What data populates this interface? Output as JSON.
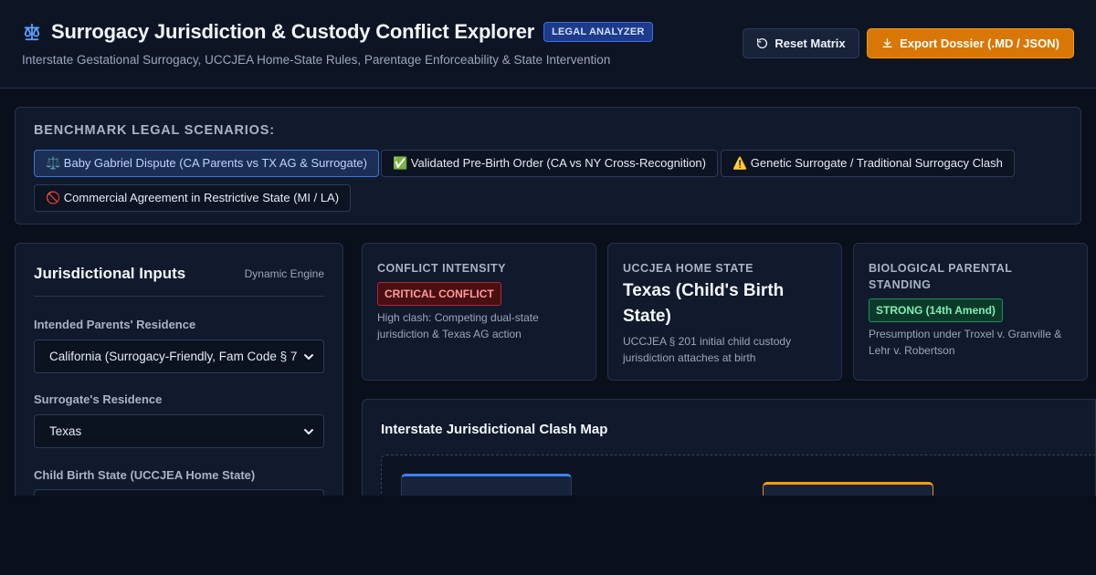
{
  "header": {
    "title": "Surrogacy Jurisdiction & Custody Conflict Explorer",
    "badge": "LEGAL ANALYZER",
    "subtitle": "Interstate Gestational Surrogacy, UCCJEA Home-State Rules, Parentage Enforceability & State Intervention",
    "icon": "scales-icon",
    "reset_label": "Reset Matrix",
    "export_label": "Export Dossier (.MD / JSON)"
  },
  "scenarios": {
    "title": "BENCHMARK LEGAL SCENARIOS:",
    "items": [
      {
        "label": "⚖️ Baby Gabriel Dispute (CA Parents vs TX AG & Surrogate)",
        "active": true
      },
      {
        "label": "✅ Validated Pre-Birth Order (CA vs NY Cross-Recognition)",
        "active": false
      },
      {
        "label": "⚠️ Genetic Surrogate / Traditional Surrogacy Clash",
        "active": false
      },
      {
        "label": "🚫 Commercial Agreement in Restrictive State (MI / LA)",
        "active": false
      }
    ]
  },
  "inputs": {
    "title": "Jurisdictional Inputs",
    "tag": "Dynamic Engine",
    "fields": [
      {
        "label": "Intended Parents' Residence",
        "value": "California (Surrogacy-Friendly, Fam Code § 7"
      },
      {
        "label": "Surrogate's Residence",
        "value": "Texas"
      },
      {
        "label": "Child Birth State (UCCJEA Home State)",
        "value": ""
      }
    ]
  },
  "cards": {
    "conflict": {
      "label": "CONFLICT INTENSITY",
      "pill": "CRITICAL CONFLICT",
      "desc": "High clash: Competing dual-state jurisdiction & Texas AG action"
    },
    "home_state": {
      "label": "UCCJEA HOME STATE",
      "value": "Texas (Child's Birth State)",
      "desc": "UCCJEA § 201 initial child custody jurisdiction attaches at birth"
    },
    "bio": {
      "label": "BIOLOGICAL PARENTAL STANDING",
      "pill": "STRONG (14th Amend)",
      "desc": "Presumption under Troxel v. Granville & Lehr v. Robertson"
    }
  },
  "map": {
    "title": "Interstate Jurisdictional Clash Map"
  },
  "colors": {
    "accent_blue": "#3b82f6",
    "accent_orange": "#d97706",
    "critical": "#b32832",
    "strong": "#1f8f5e"
  }
}
